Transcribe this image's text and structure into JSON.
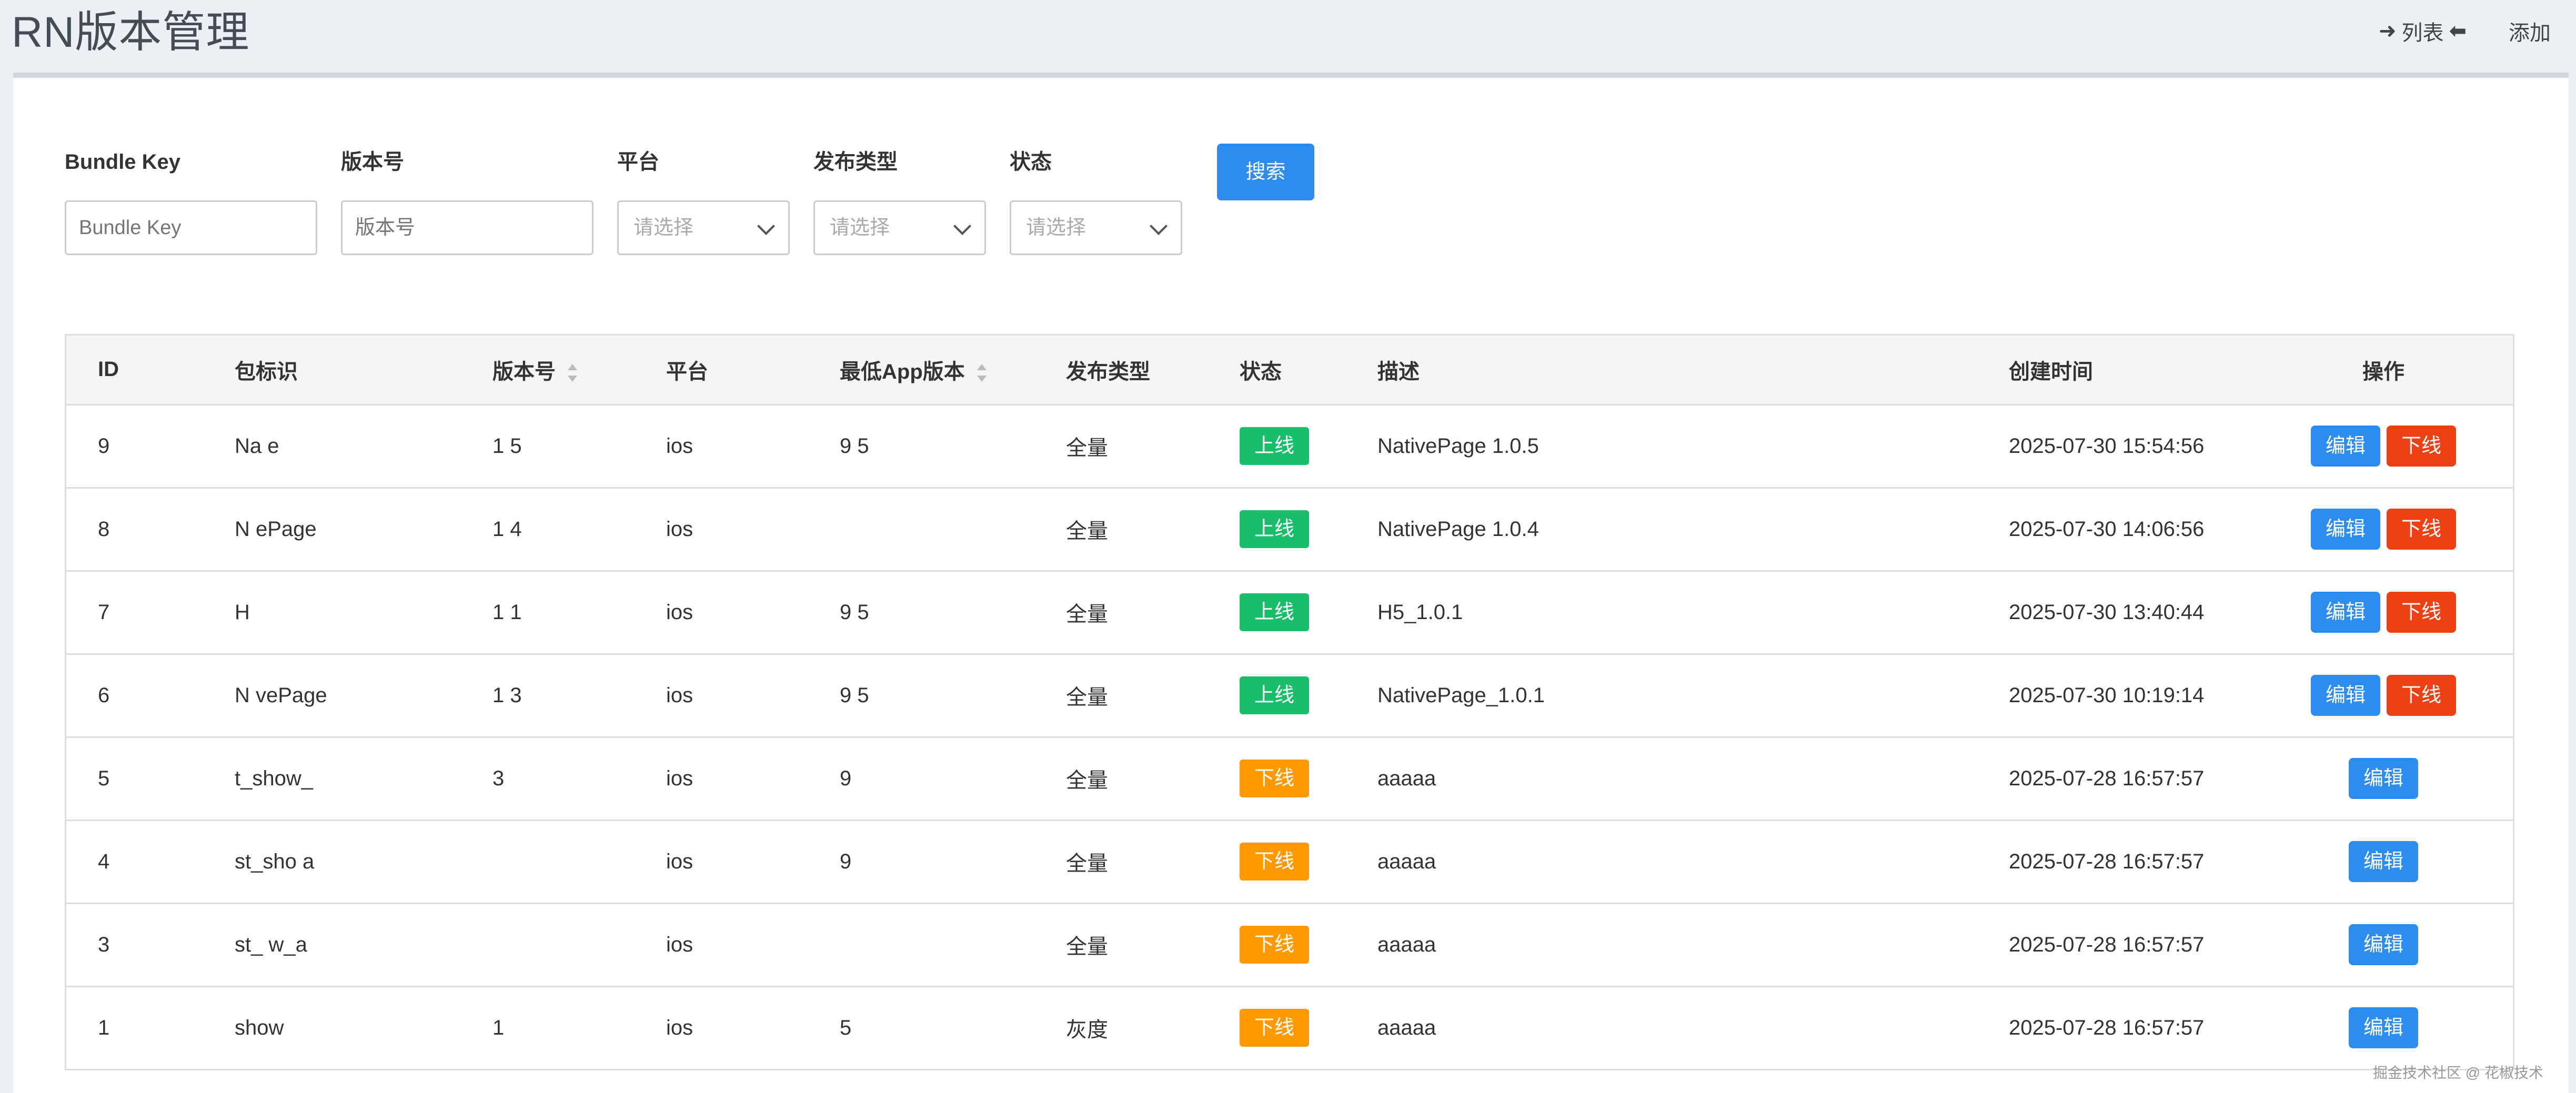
{
  "header": {
    "title": "RN版本管理",
    "list_link": "列表",
    "add_link": "添加"
  },
  "filters": {
    "search_label": "搜索",
    "fields": [
      {
        "label": "Bundle Key",
        "placeholder": "Bundle Key",
        "type": "input"
      },
      {
        "label": "版本号",
        "placeholder": "版本号",
        "type": "input"
      },
      {
        "label": "平台",
        "placeholder": "请选择",
        "type": "select"
      },
      {
        "label": "发布类型",
        "placeholder": "请选择",
        "type": "select"
      },
      {
        "label": "状态",
        "placeholder": "请选择",
        "type": "select"
      }
    ]
  },
  "table": {
    "columns": [
      "ID",
      "包标识",
      "版本号",
      "平台",
      "最低App版本",
      "发布类型",
      "状态",
      "描述",
      "创建时间",
      "操作"
    ],
    "edit_label": "编辑",
    "offline_label": "下线",
    "rows": [
      {
        "id": "9",
        "bundle": "Na  e",
        "version": "1 5",
        "platform": "ios",
        "min_app": "9 5",
        "release_type": "全量",
        "status": "上线",
        "desc": "NativePage 1.0.5",
        "created": "2025-07-30 15:54:56"
      },
      {
        "id": "8",
        "bundle": "N ePage",
        "version": "1 4",
        "platform": "ios",
        "min_app": "",
        "release_type": "全量",
        "status": "上线",
        "desc": "NativePage 1.0.4",
        "created": "2025-07-30 14:06:56"
      },
      {
        "id": "7",
        "bundle": "H",
        "version": "1 1",
        "platform": "ios",
        "min_app": "9 5",
        "release_type": "全量",
        "status": "上线",
        "desc": "H5_1.0.1",
        "created": "2025-07-30 13:40:44"
      },
      {
        "id": "6",
        "bundle": "N vePage",
        "version": "1 3",
        "platform": "ios",
        "min_app": "9 5",
        "release_type": "全量",
        "status": "上线",
        "desc": "NativePage_1.0.1",
        "created": "2025-07-30 10:19:14"
      },
      {
        "id": "5",
        "bundle": "t_show_",
        "version": "3",
        "platform": "ios",
        "min_app": "9",
        "release_type": "全量",
        "status": "下线",
        "desc": "aaaaa",
        "created": "2025-07-28 16:57:57"
      },
      {
        "id": "4",
        "bundle": "st_sho a",
        "version": "",
        "platform": "ios",
        "min_app": "9",
        "release_type": "全量",
        "status": "下线",
        "desc": "aaaaa",
        "created": "2025-07-28 16:57:57"
      },
      {
        "id": "3",
        "bundle": "st_ w_a",
        "version": "",
        "platform": "ios",
        "min_app": "",
        "release_type": "全量",
        "status": "下线",
        "desc": "aaaaa",
        "created": "2025-07-28 16:57:57"
      },
      {
        "id": "1",
        "bundle": "show",
        "version": "1",
        "platform": "ios",
        "min_app": "5",
        "release_type": "灰度",
        "status": "下线",
        "desc": "aaaaa",
        "created": "2025-07-28 16:57:57"
      }
    ]
  },
  "watermark": "掘金技术社区 @ 花椒技术",
  "colors": {
    "primary": "#2d8cf0",
    "online": "#19be6b",
    "offline_badge": "#ff9900",
    "danger": "#ed4014"
  }
}
